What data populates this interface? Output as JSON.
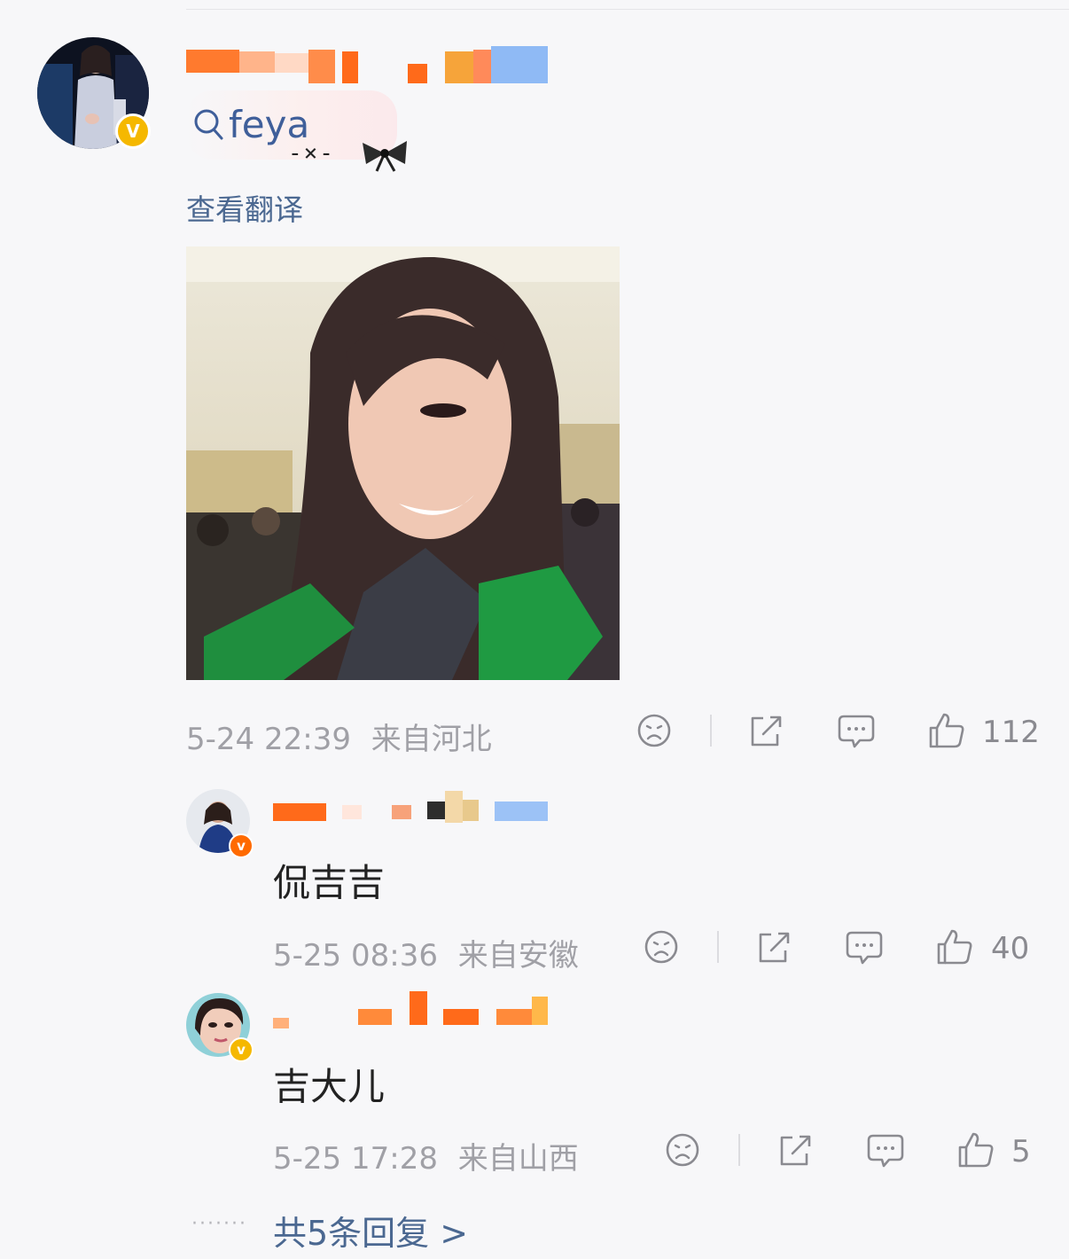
{
  "comment": {
    "author_badge": "V",
    "search_hint": "feya",
    "translate_label": "查看翻译",
    "timestamp": "5-24 22:39",
    "location": "来自河北",
    "like_count": "112"
  },
  "replies": [
    {
      "badge": "v",
      "text": "侃吉吉",
      "timestamp": "5-25 08:36",
      "location": "来自安徽",
      "like_count": "40"
    },
    {
      "badge": "v",
      "text": "吉大儿",
      "timestamp": "5-25 17:28",
      "location": "来自山西",
      "like_count": "5"
    }
  ],
  "more": {
    "dots": "·······",
    "label": "共5条回复 >"
  },
  "icons": [
    "sad-face-icon",
    "share-icon",
    "comment-icon",
    "thumbs-up-icon",
    "search-icon",
    "bow-icon"
  ],
  "colors": {
    "link": "#4b6891",
    "meta": "#a0a0a6",
    "verified_gold": "#f5b800",
    "verified_orange": "#ff6a00"
  }
}
